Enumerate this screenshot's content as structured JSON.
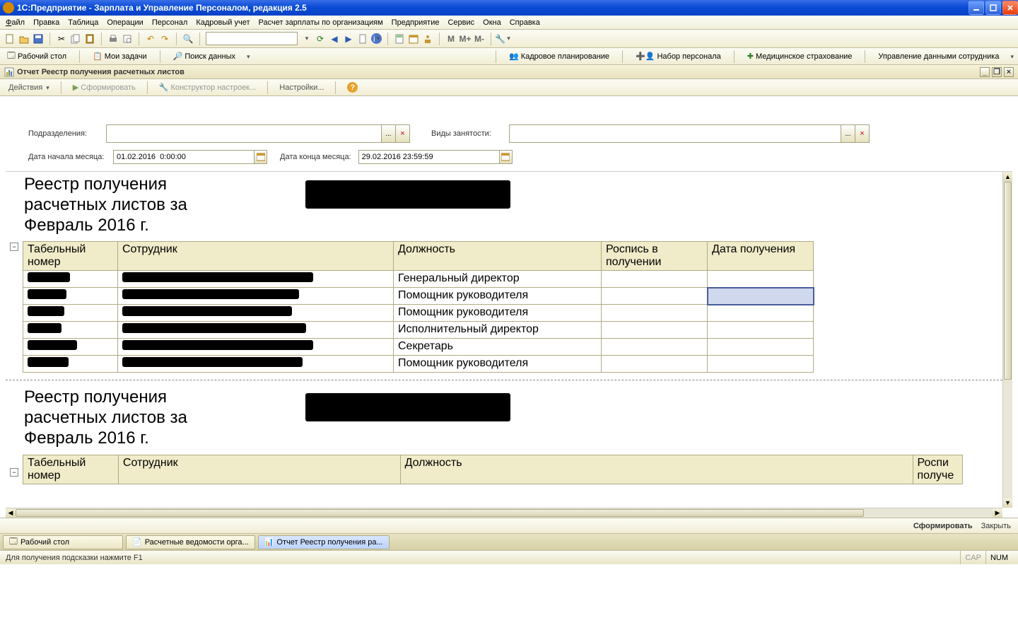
{
  "window": {
    "title": "1С:Предприятие - Зарплата и Управление Персоналом, редакция 2.5"
  },
  "menu": {
    "file": "Файл",
    "edit": "Правка",
    "table": "Таблица",
    "operations": "Операции",
    "personnel": "Персонал",
    "hr_accounting": "Кадровый учет",
    "payroll": "Расчет зарплаты по организациям",
    "enterprise": "Предприятие",
    "service": "Сервис",
    "windows": "Окна",
    "help": "Справка"
  },
  "shortcuts": {
    "desktop": "Рабочий стол",
    "my_tasks": "Мои задачи",
    "data_search": "Поиск данных",
    "hr_planning": "Кадровое планирование",
    "recruitment": "Набор персонала",
    "med_insurance": "Медицинское страхование",
    "data_management": "Управление данными сотрудника"
  },
  "doc": {
    "title": "Отчет  Реестр получения расчетных листов"
  },
  "actions": {
    "actions_btn": "Действия",
    "generate": "Сформировать",
    "settings_constructor": "Конструктор настроек...",
    "settings": "Настройки..."
  },
  "filters": {
    "departments_label": "Подразделения:",
    "employment_types_label": "Виды занятости:",
    "date_start_label": "Дата начала месяца:",
    "date_start_value": "01.02.2016  0:00:00",
    "date_end_label": "Дата конца месяца:",
    "date_end_value": "29.02.2016 23:59:59"
  },
  "report": {
    "title1": "Реестр получения расчетных листов за Февраль 2016 г.",
    "title2": "Реестр получения расчетных листов за Февраль 2016 г.",
    "columns": {
      "tab_no": "Табельный номер",
      "employee": "Сотрудник",
      "position": "Должность",
      "signature": "Роспись в получении",
      "date_received": "Дата получения",
      "signature_short": "Роспись в получении"
    },
    "rows1": [
      {
        "position": "Генеральный директор"
      },
      {
        "position": "Помощник руководителя"
      },
      {
        "position": "Помощник руководителя"
      },
      {
        "position": "Исполнительный директор"
      },
      {
        "position": "Секретарь"
      },
      {
        "position": "Помощник руководителя"
      }
    ]
  },
  "footer": {
    "generate": "Сформировать",
    "close": "Закрыть"
  },
  "tabs": {
    "desktop": "Рабочий стол",
    "payroll_sheets": "Расчетные ведомости орга...",
    "report": "Отчет  Реестр получения ра..."
  },
  "status": {
    "hint": "Для получения подсказки нажмите F1",
    "cap": "CAP",
    "num": "NUM"
  },
  "toolbar_glyphs": {
    "m": "M",
    "m_plus": "M+",
    "m_minus": "M-"
  }
}
